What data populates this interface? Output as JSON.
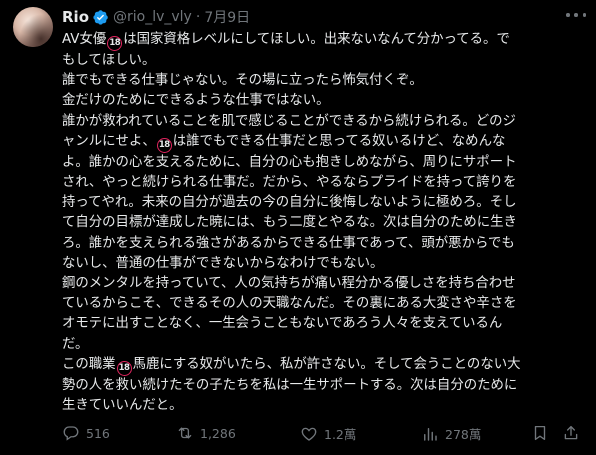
{
  "author": {
    "name": "Rio",
    "handle": "@rio_lv_vly",
    "separator": "·",
    "time": "7月9日"
  },
  "tweet": {
    "lines": [
      {
        "pre": "AV女優",
        "badge": "18",
        "post": "は国家資格レベルにしてほしい。出来ないなんて分かってる。で"
      },
      {
        "pre": "もしてほしい。",
        "badge": "",
        "post": ""
      },
      {
        "pre": "誰でもできる仕事じゃない。その場に立ったら怖気付くぞ。",
        "badge": "",
        "post": ""
      },
      {
        "pre": "金だけのためにできるような仕事ではない。",
        "badge": "",
        "post": ""
      },
      {
        "pre": "誰かが救われていることを肌で感じることができるから続けられる。どのジ",
        "badge": "",
        "post": ""
      },
      {
        "pre": "ャンルにせよ、",
        "badge": "18",
        "post": "は誰でもできる仕事だと思ってる奴いるけど、なめんな"
      },
      {
        "pre": "よ。誰かの心を支えるために、自分の心も抱きしめながら、周りにサポート",
        "badge": "",
        "post": ""
      },
      {
        "pre": "され、やっと続けられる仕事だ。だから、やるならプライドを持って誇りを",
        "badge": "",
        "post": ""
      },
      {
        "pre": "持ってやれ。未来の自分が過去の今の自分に後悔しないように極めろ。そし",
        "badge": "",
        "post": ""
      },
      {
        "pre": "て自分の目標が達成した暁には、もう二度とやるな。次は自分のために生き",
        "badge": "",
        "post": ""
      },
      {
        "pre": "ろ。誰かを支えられる強さがあるからできる仕事であって、頭が悪からでも",
        "badge": "",
        "post": ""
      },
      {
        "pre": "ないし、普通の仕事ができないからなわけでもない。",
        "badge": "",
        "post": ""
      },
      {
        "pre": "鋼のメンタルを持っていて、人の気持ちが痛い程分かる優しさを持ち合わせ",
        "badge": "",
        "post": ""
      },
      {
        "pre": "ているからこそ、できるその人の天職なんだ。その裏にある大変さや辛さを",
        "badge": "",
        "post": ""
      },
      {
        "pre": "オモテに出すことなく、一生会うこともないであろう人々を支えているん",
        "badge": "",
        "post": ""
      },
      {
        "pre": "だ。",
        "badge": "",
        "post": ""
      },
      {
        "pre": "この職業",
        "badge": "18",
        "post": "馬鹿にする奴がいたら、私が許さない。そして会うことのない大"
      },
      {
        "pre": "勢の人を救い続けたその子たちを私は一生サポートする。次は自分のために",
        "badge": "",
        "post": ""
      },
      {
        "pre": "生きていいんだと。",
        "badge": "",
        "post": ""
      }
    ]
  },
  "actions": {
    "reply_count": "516",
    "repost_count": "1,286",
    "like_count": "1.2萬",
    "view_count": "278萬"
  },
  "icons": {
    "verified": "verified-badge-icon",
    "more": "more-options-icon",
    "reply": "reply-icon",
    "repost": "repost-icon",
    "like": "heart-icon",
    "views": "views-chart-icon",
    "bookmark": "bookmark-icon",
    "share": "share-icon"
  },
  "colors": {
    "background": "#000000",
    "text": "#e7e9ea",
    "muted": "#71767b",
    "verified": "#1d9bf0",
    "badge_ring": "#e0245e"
  }
}
